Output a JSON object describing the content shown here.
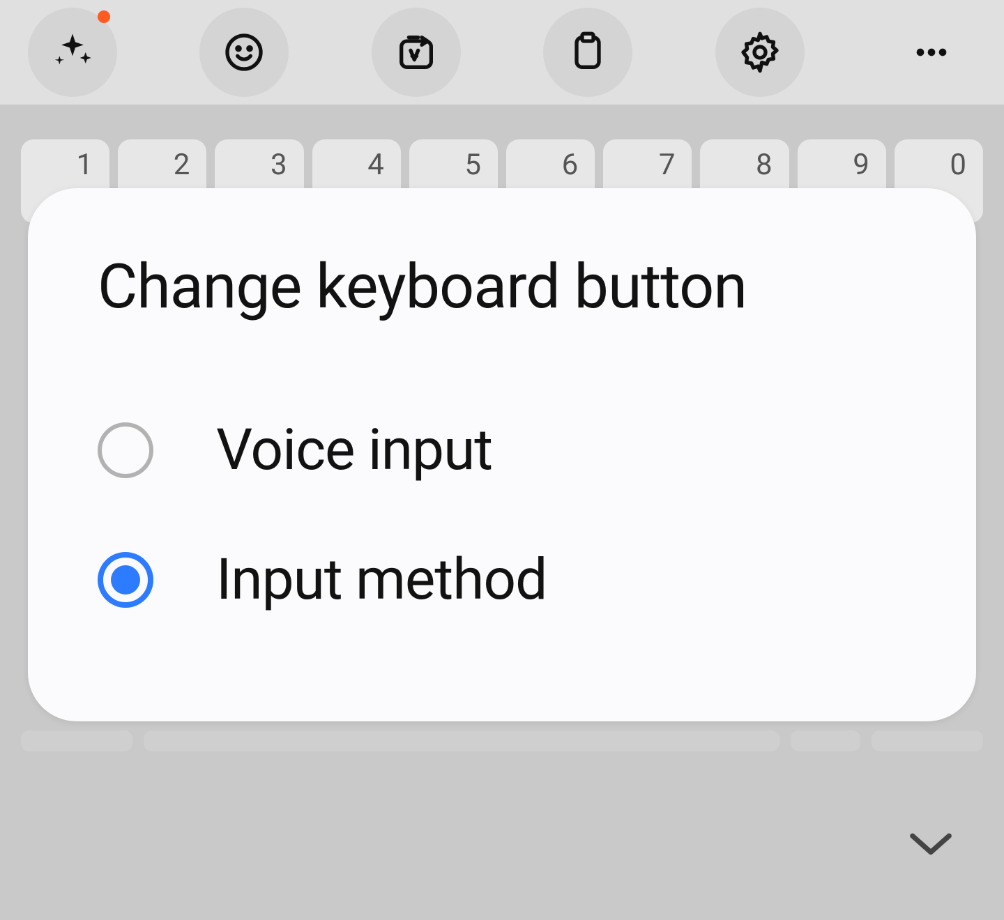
{
  "toolbar": {
    "magic_has_notification": true
  },
  "keyboard": {
    "number_row": [
      "1",
      "2",
      "3",
      "4",
      "5",
      "6",
      "7",
      "8",
      "9",
      "0"
    ]
  },
  "modal": {
    "title": "Change keyboard button",
    "options": [
      {
        "label": "Voice input",
        "selected": false
      },
      {
        "label": "Input method",
        "selected": true
      }
    ]
  }
}
